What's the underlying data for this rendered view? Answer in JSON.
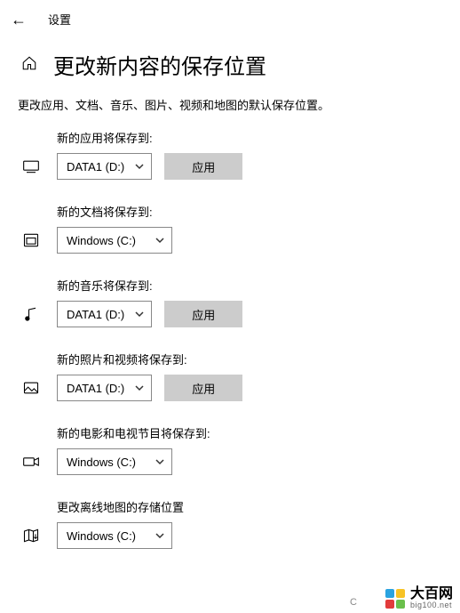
{
  "header": {
    "settings_label": "设置"
  },
  "title": "更改新内容的保存位置",
  "subtitle": "更改应用、文档、音乐、图片、视频和地图的默认保存位置。",
  "apply_label": "应用",
  "sections": {
    "apps": {
      "label": "新的应用将保存到:",
      "value": "DATA1 (D:)",
      "show_apply": true,
      "wide": false
    },
    "documents": {
      "label": "新的文档将保存到:",
      "value": "Windows (C:)",
      "show_apply": false,
      "wide": true
    },
    "music": {
      "label": "新的音乐将保存到:",
      "value": "DATA1 (D:)",
      "show_apply": true,
      "wide": false
    },
    "photos": {
      "label": "新的照片和视频将保存到:",
      "value": "DATA1 (D:)",
      "show_apply": true,
      "wide": false
    },
    "movies": {
      "label": "新的电影和电视节目将保存到:",
      "value": "Windows (C:)",
      "show_apply": false,
      "wide": true
    },
    "maps": {
      "label": "更改离线地图的存储位置",
      "value": "Windows (C:)",
      "show_apply": false,
      "wide": true
    }
  },
  "watermark": {
    "cn": "大百网",
    "en": "big100.net",
    "c": "C"
  },
  "logo_colors": {
    "tl": "#2aa3e0",
    "tr": "#f7c325",
    "bl": "#e23b3b",
    "br": "#6abf4b"
  }
}
